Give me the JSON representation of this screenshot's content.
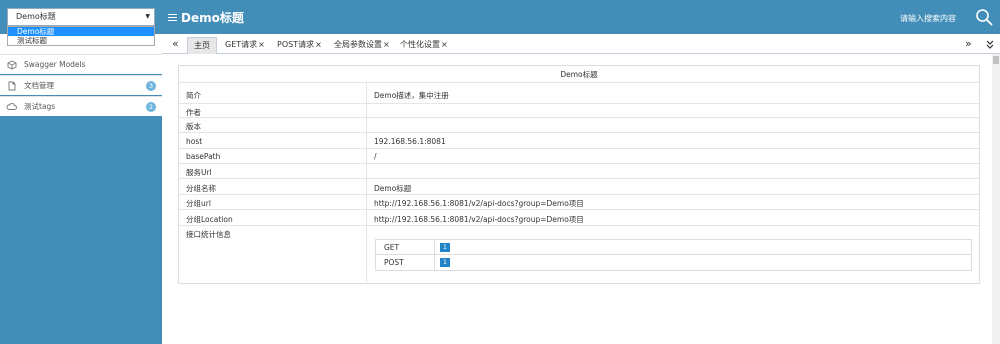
{
  "header": {
    "group_select_value": "Demo标题",
    "brand_title": "Demo标题",
    "search_placeholder": "请输入搜索内容"
  },
  "group_dropdown": {
    "options": [
      "Demo标题",
      "测试标题"
    ],
    "selected": "Demo标题"
  },
  "sidebar": {
    "items": [
      {
        "label": "Swagger Models",
        "icon": "cube-icon",
        "badge": ""
      },
      {
        "label": "文档管理",
        "icon": "document-icon",
        "badge": "3"
      },
      {
        "label": "测试tags",
        "icon": "cloud-icon",
        "badge": "2"
      }
    ]
  },
  "tabs": {
    "prev": "«",
    "next": "»",
    "more": "⌄",
    "items": [
      {
        "label": "主页",
        "close": ""
      },
      {
        "label": "GET请求",
        "close": "×"
      },
      {
        "label": "POST请求",
        "close": "×"
      },
      {
        "label": "全局参数设置",
        "close": "×"
      },
      {
        "label": "个性化设置",
        "close": "×"
      }
    ]
  },
  "doc": {
    "title": "Demo标题",
    "rows": [
      {
        "key": "简介",
        "value": "Demo描述，集中注册"
      },
      {
        "key": "作者",
        "value": ""
      },
      {
        "key": "版本",
        "value": ""
      },
      {
        "key": "host",
        "value": "192.168.56.1:8081"
      },
      {
        "key": "basePath",
        "value": "/"
      },
      {
        "key": "服务Url",
        "value": ""
      },
      {
        "key": "分组名称",
        "value": "Demo标题"
      },
      {
        "key": "分组url",
        "value": "http://192.168.56.1:8081/v2/api-docs?group=Demo项目"
      },
      {
        "key": "分组Location",
        "value": "http://192.168.56.1:8081/v2/api-docs?group=Demo项目"
      },
      {
        "key": "接口统计信息",
        "value": ""
      }
    ],
    "stats": [
      {
        "method": "GET",
        "count": "1"
      },
      {
        "method": "POST",
        "count": "1"
      }
    ]
  },
  "colors": {
    "header_bg": "#438eb9",
    "badge_bg": "#6fb3e0",
    "count_badge_bg": "#2283c5",
    "dropdown_highlight": "#1e90ff"
  }
}
